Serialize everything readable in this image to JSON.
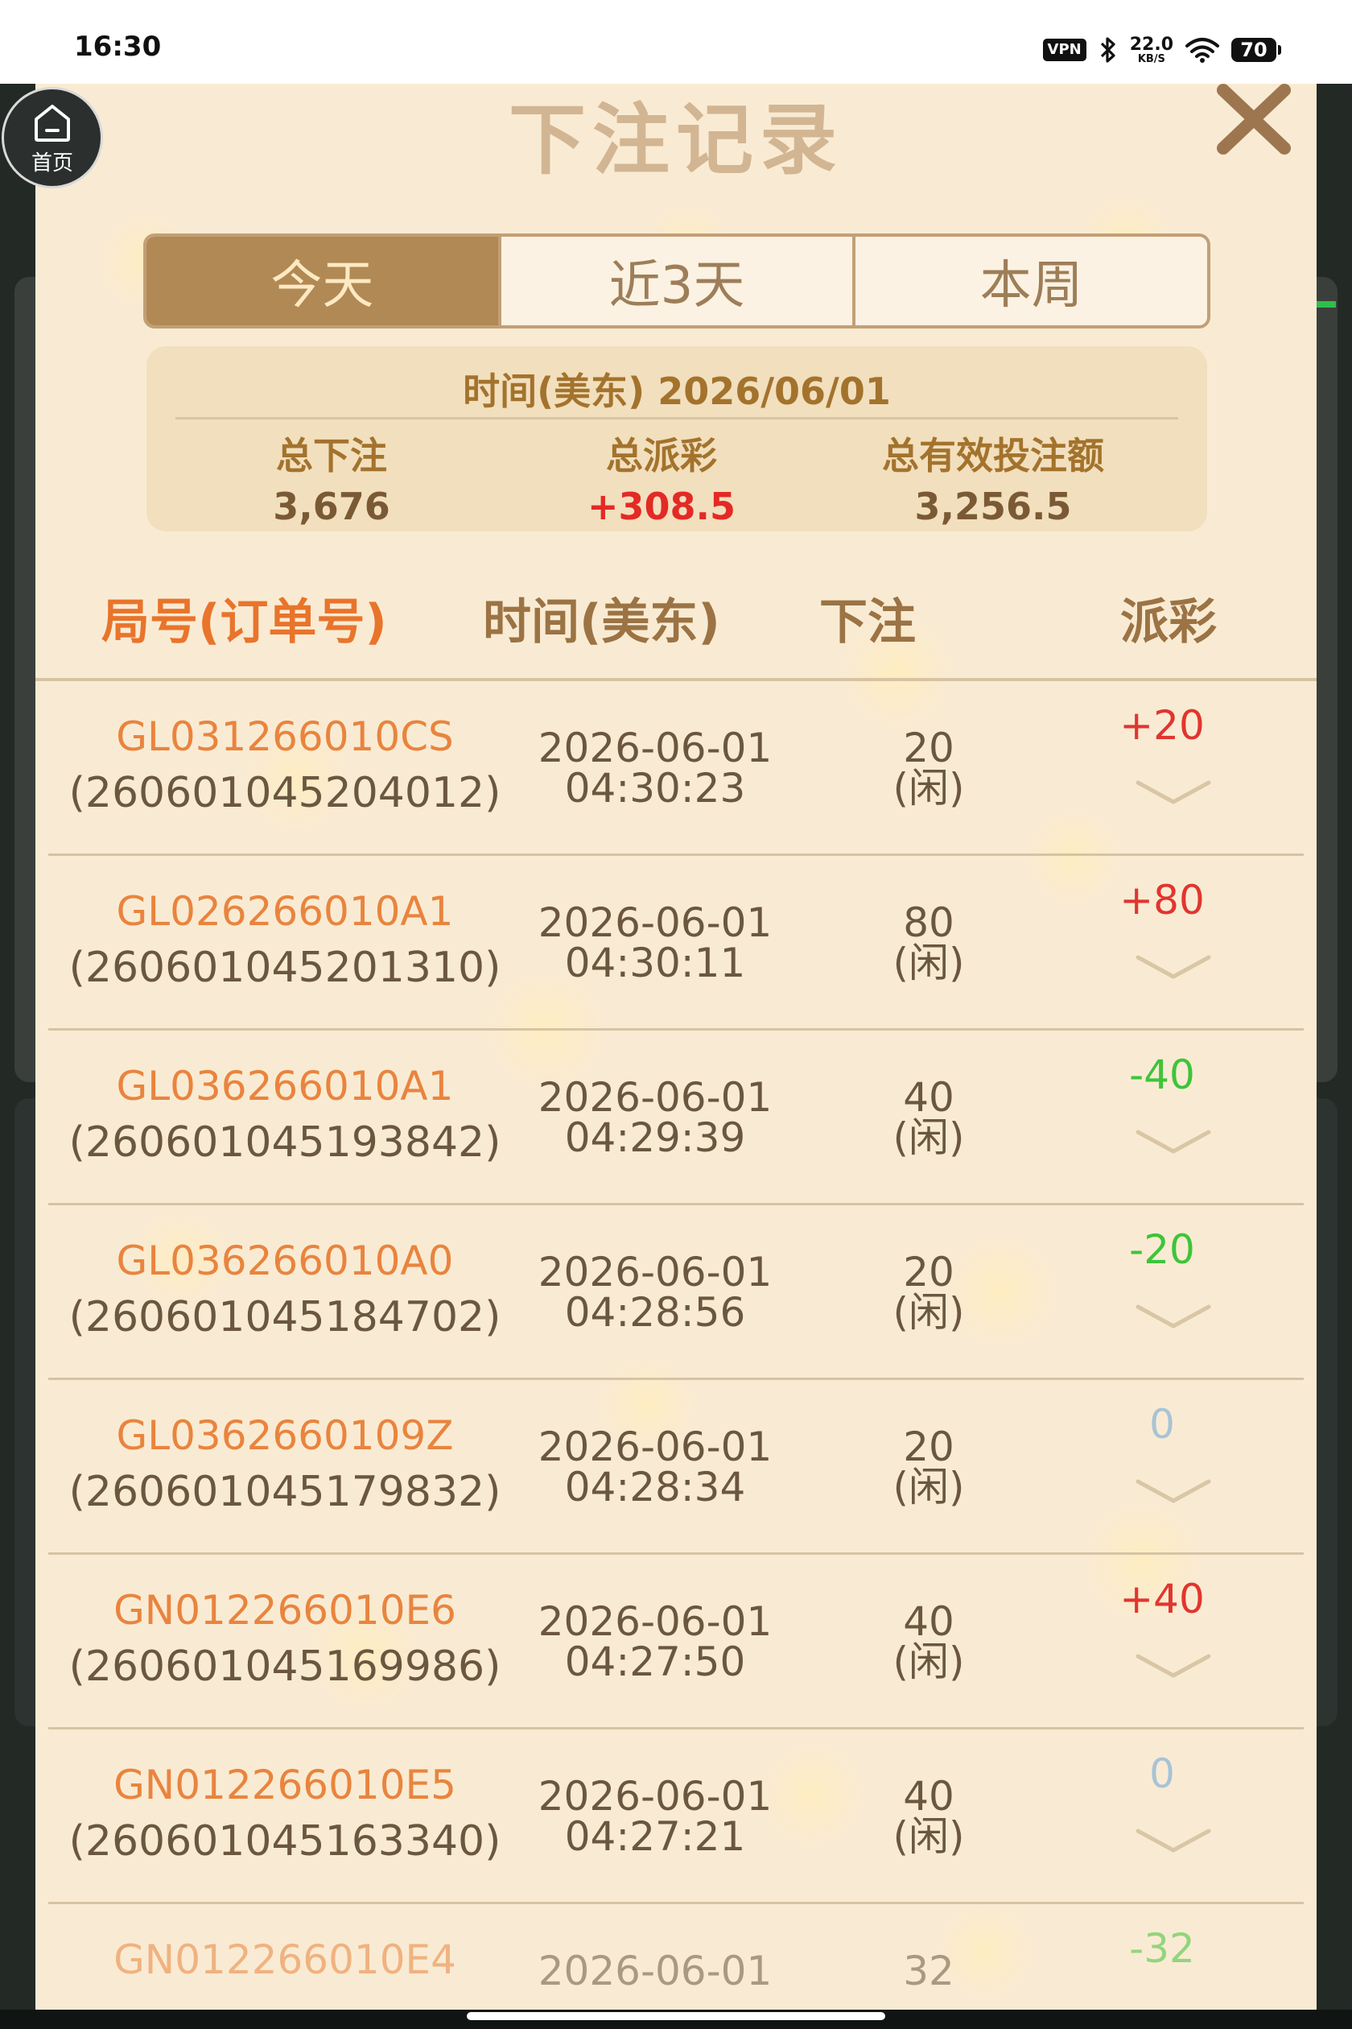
{
  "status_bar": {
    "time": "16:30",
    "vpn": "VPN",
    "speed_value": "22.0",
    "speed_unit": "KB/S",
    "battery": "70",
    "icons": [
      "bluetooth-icon",
      "wifi-icon"
    ]
  },
  "home": {
    "label": "首页",
    "icon": "home-icon"
  },
  "modal": {
    "title": "下注记录",
    "close_icon": "close-icon",
    "tabs": [
      {
        "label": "今天",
        "active": true
      },
      {
        "label": "近3天",
        "active": false
      },
      {
        "label": "本周",
        "active": false
      }
    ],
    "summary": {
      "date": "时间(美东) 2026/06/01",
      "total_bet_label": "总下注",
      "total_bet_value": "3,676",
      "total_payout_label": "总派彩",
      "total_payout_value": "+308.5",
      "total_valid_label": "总有效投注额",
      "total_valid_value": "3,256.5"
    },
    "table": {
      "headers": [
        "局号(订单号)",
        "时间(美东)",
        "下注",
        "派彩"
      ],
      "rows": [
        {
          "code": "GL031266010CS",
          "order": "(260601045204012)",
          "date": "2026-06-01",
          "time": "04:30:23",
          "bet": "20",
          "side": "(闲)",
          "payout": "+20"
        },
        {
          "code": "GL026266010A1",
          "order": "(260601045201310)",
          "date": "2026-06-01",
          "time": "04:30:11",
          "bet": "80",
          "side": "(闲)",
          "payout": "+80"
        },
        {
          "code": "GL036266010A1",
          "order": "(260601045193842)",
          "date": "2026-06-01",
          "time": "04:29:39",
          "bet": "40",
          "side": "(闲)",
          "payout": "-40"
        },
        {
          "code": "GL036266010A0",
          "order": "(260601045184702)",
          "date": "2026-06-01",
          "time": "04:28:56",
          "bet": "20",
          "side": "(闲)",
          "payout": "-20"
        },
        {
          "code": "GL0362660109Z",
          "order": "(260601045179832)",
          "date": "2026-06-01",
          "time": "04:28:34",
          "bet": "20",
          "side": "(闲)",
          "payout": "0"
        },
        {
          "code": "GN012266010E6",
          "order": "(260601045169986)",
          "date": "2026-06-01",
          "time": "04:27:50",
          "bet": "40",
          "side": "(闲)",
          "payout": "+40"
        },
        {
          "code": "GN012266010E5",
          "order": "(260601045163340)",
          "date": "2026-06-01",
          "time": "04:27:21",
          "bet": "40",
          "side": "(闲)",
          "payout": "0"
        },
        {
          "code": "GN012266010E4",
          "order": "",
          "date": "2026-06-01",
          "time": "",
          "bet": "32",
          "side": "",
          "payout": "-32"
        }
      ]
    }
  },
  "colors": {
    "modal_bg": "#f9ebd3",
    "tab_active": "#b08954",
    "accent_orange": "#e9843e",
    "payout_positive": "#e1352f",
    "payout_negative": "#3ec43a",
    "payout_zero": "#a9c3d6"
  }
}
